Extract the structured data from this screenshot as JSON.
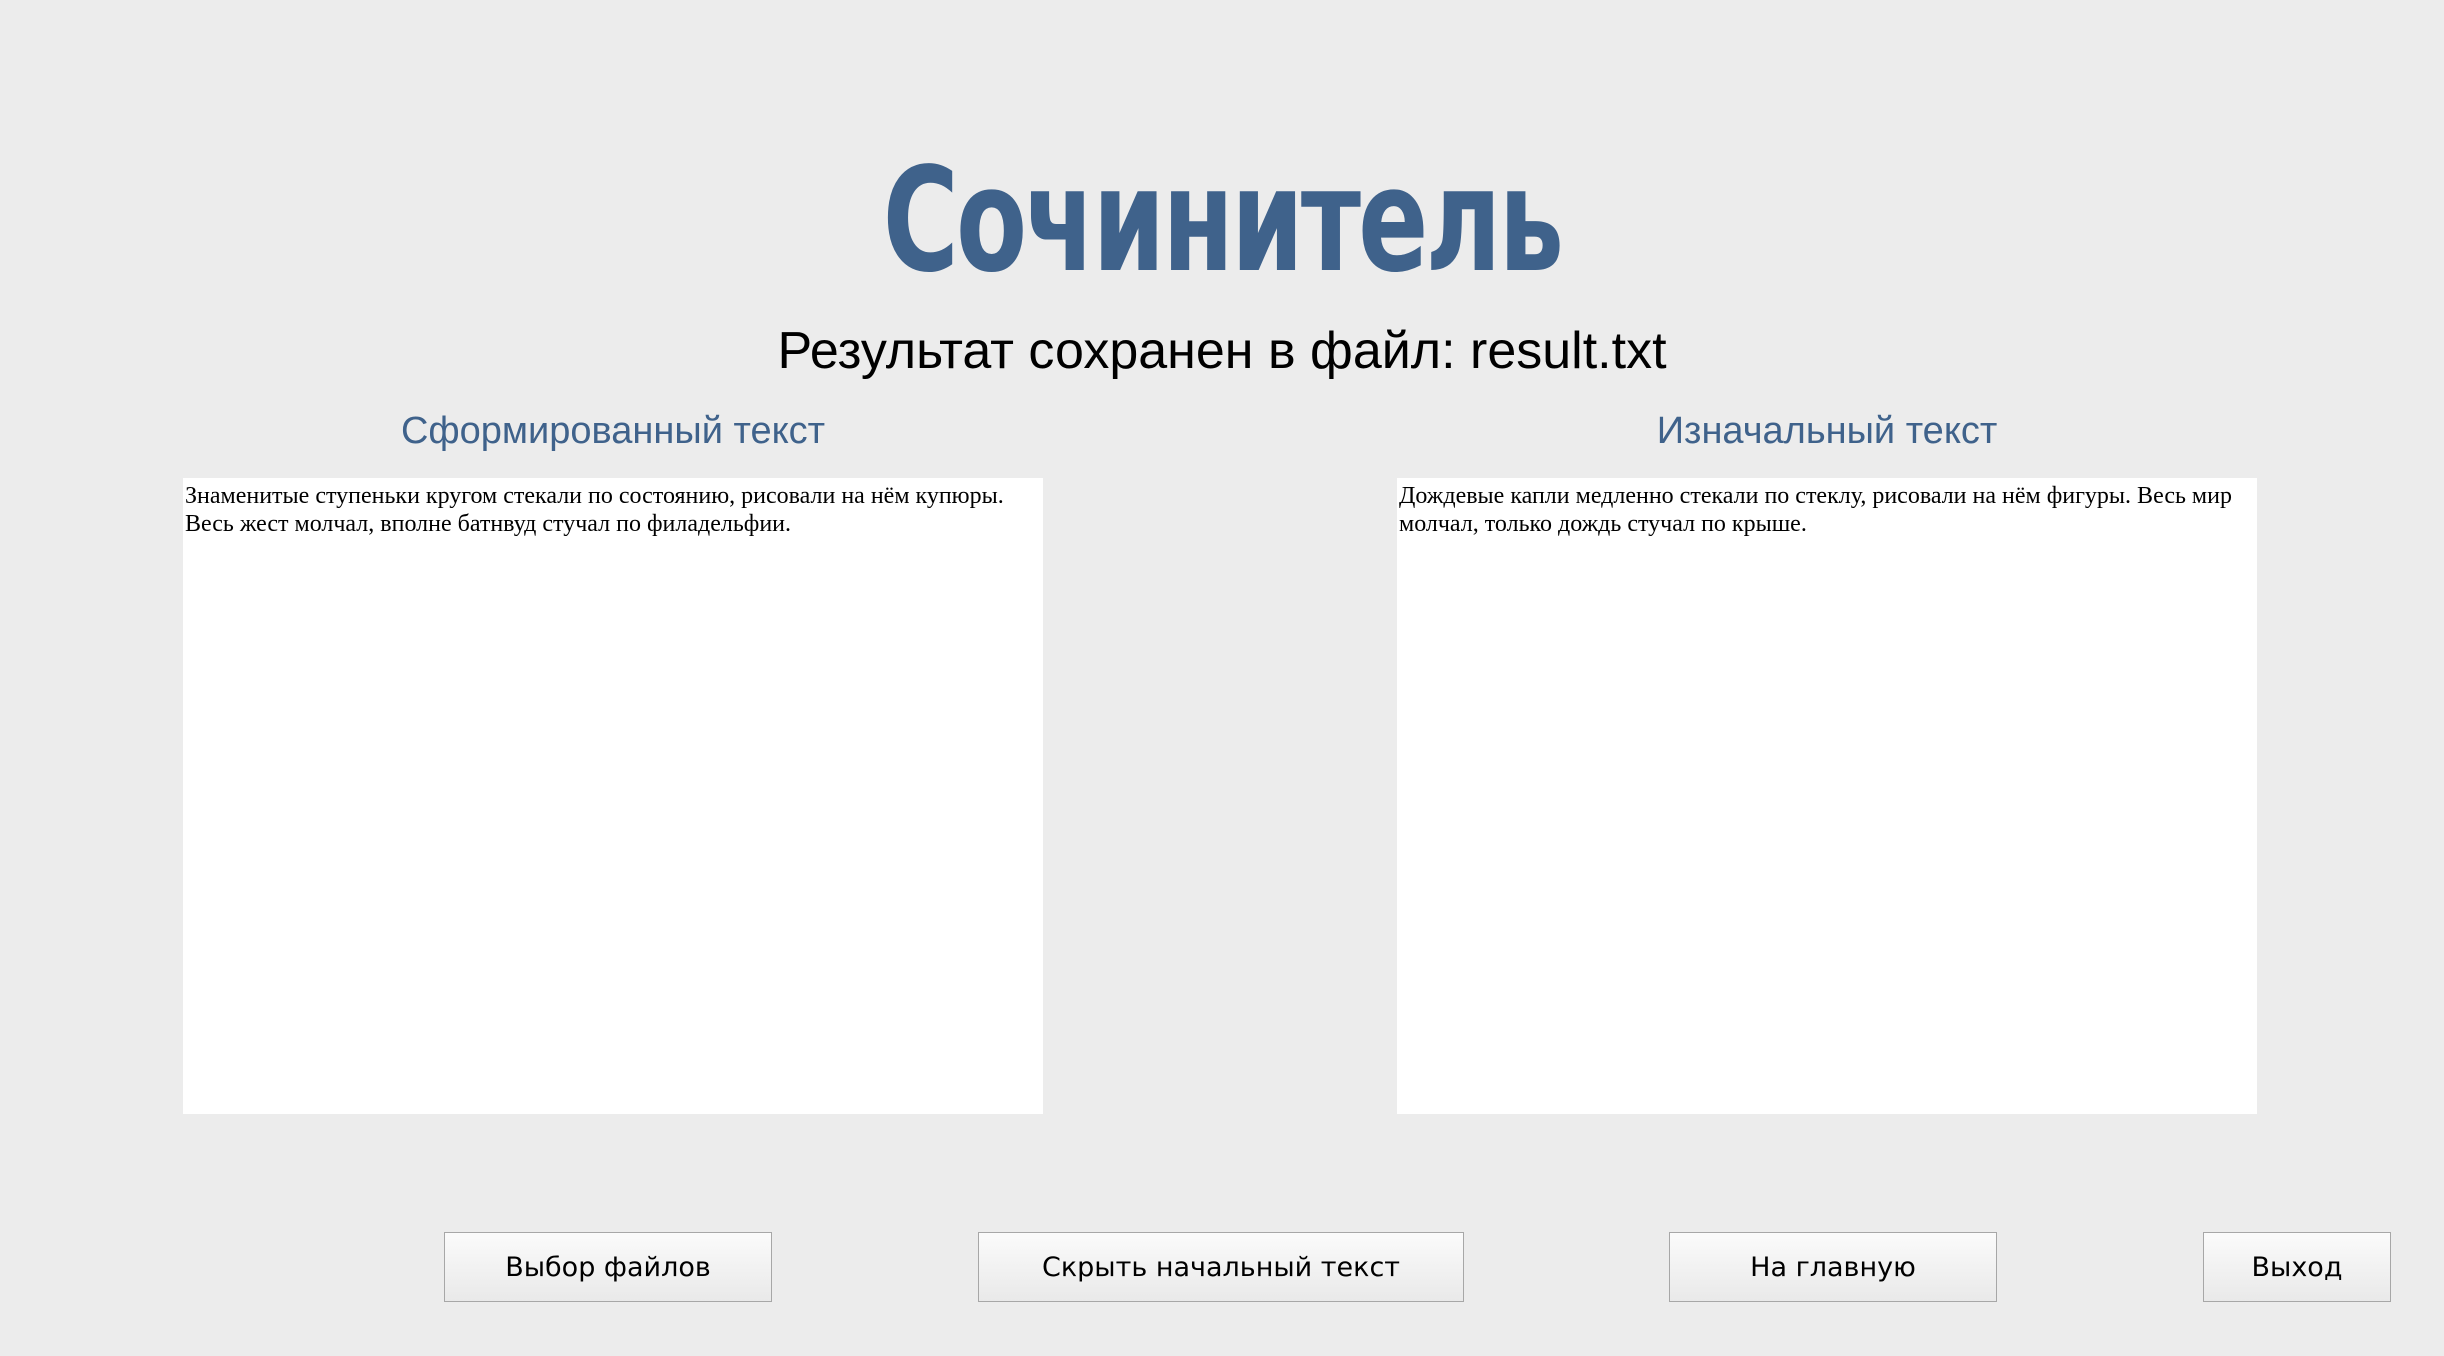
{
  "app": {
    "title": "Сочинитель",
    "status": "Результат сохранен в файл: result.txt"
  },
  "panels": {
    "generated": {
      "heading": "Сформированный текст",
      "content": "Знаменитые ступеньки кругом стекали по состоянию, рисовали на нём купюры. Весь жест молчал, вполне батнвуд стучал по филадельфии."
    },
    "original": {
      "heading": "Изначальный текст",
      "content": "Дождевые капли медленно стекали по стеклу, рисовали на нём фигуры. Весь мир молчал, только дождь стучал по крыше."
    }
  },
  "buttons": {
    "choose_files": "Выбор файлов",
    "hide_original": "Скрыть начальный текст",
    "home": "На главную",
    "exit": "Выход"
  },
  "colors": {
    "accent": "#3f628b",
    "background": "#ececec",
    "panel": "#ffffff"
  }
}
